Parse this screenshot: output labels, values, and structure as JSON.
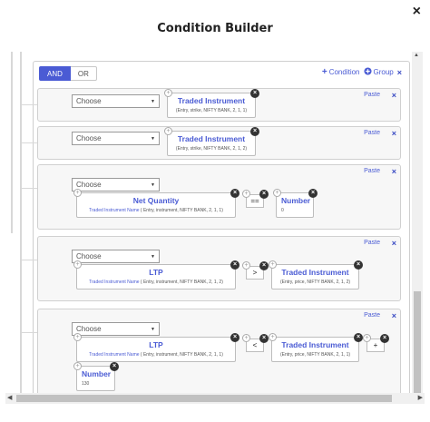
{
  "dialog": {
    "title": "Condition Builder",
    "close": "×"
  },
  "group": {
    "and_label": "AND",
    "or_label": "OR",
    "add_condition": "Condition",
    "add_group": "Group",
    "remove": "×"
  },
  "rules": [
    {
      "choose": "Choose",
      "paste": "Paste",
      "remove": "×",
      "lhs": {
        "title": "Traded Instrument",
        "sub": "(Entry, strike, NIFTY BANK, 2, 1, 1)"
      }
    },
    {
      "choose": "Choose",
      "paste": "Paste",
      "remove": "×",
      "lhs": {
        "title": "Traded Instrument",
        "sub": "(Entry, strike, NIFTY BANK, 2, 1, 2)"
      }
    },
    {
      "choose": "Choose",
      "paste": "Paste",
      "remove": "×",
      "lhs": {
        "title": "Net Quantity",
        "sub_link": "Traded Instrument Name",
        "sub": " ( Entry, instrument, NIFTY BANK, 2, 1, 1)"
      },
      "op": "==",
      "rhs": {
        "title": "Number",
        "sub": "0"
      }
    },
    {
      "choose": "Choose",
      "paste": "Paste",
      "remove": "×",
      "lhs": {
        "title": "LTP",
        "sub_link": "Traded Instrument Name",
        "sub": " ( Entry, instrument, NIFTY BANK, 2, 1, 2)"
      },
      "op": ">",
      "rhs": {
        "title": "Traded Instrument",
        "sub": "(Entry, price, NIFTY BANK, 2, 1, 2)"
      }
    },
    {
      "choose": "Choose",
      "paste": "Paste",
      "remove": "×",
      "lhs": {
        "title": "LTP",
        "sub_link": "Traded Instrument Name",
        "sub": " ( Entry, instrument, NIFTY BANK, 2, 1, 1)"
      },
      "op": "<",
      "rhs": {
        "title": "Traded Instrument",
        "sub": "(Entry, price, NIFTY BANK, 2, 1, 1)"
      },
      "op2": "+",
      "rhs2": {
        "title": "Number",
        "sub": "130"
      }
    }
  ],
  "icons": {
    "plus": "plus-icon",
    "caret": "caret-down-icon",
    "close": "close-icon"
  },
  "colors": {
    "accent": "#4a5bd4",
    "badge": "#333333"
  }
}
